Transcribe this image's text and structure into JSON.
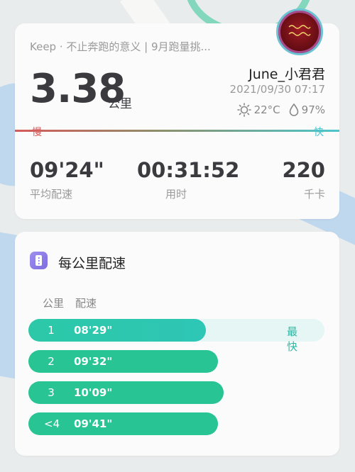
{
  "summary": {
    "subtitle": "Keep · 不止奔跑的意义 | 9月跑量挑...",
    "distance": "3.38",
    "distance_unit": "公里",
    "user_name": "June_小君君",
    "datetime": "2021/09/30 07:17",
    "temperature": "22°C",
    "humidity": "97%",
    "slow_label": "慢",
    "fast_label": "快",
    "avg_pace": {
      "value": "09'24\"",
      "label": "平均配速"
    },
    "duration": {
      "value": "00:31:52",
      "label": "用时"
    },
    "calories": {
      "value": "220",
      "label": "千卡"
    }
  },
  "pace_section": {
    "title": "每公里配速",
    "col_km": "公里",
    "col_pace": "配速",
    "rows": [
      {
        "km": "1",
        "pace": "08'29\"",
        "badge": "最快",
        "fraction": 0.6
      },
      {
        "km": "2",
        "pace": "09'32\"",
        "badge": "",
        "fraction": 0.64
      },
      {
        "km": "3",
        "pace": "10'09\"",
        "badge": "",
        "fraction": 0.66
      },
      {
        "km": "<4",
        "pace": "09'41\"",
        "badge": "",
        "fraction": 0.64
      }
    ]
  },
  "colors": {
    "accent_green": "#28c493",
    "slow_red": "#d65a5a",
    "fast_cyan": "#47c4cf"
  }
}
